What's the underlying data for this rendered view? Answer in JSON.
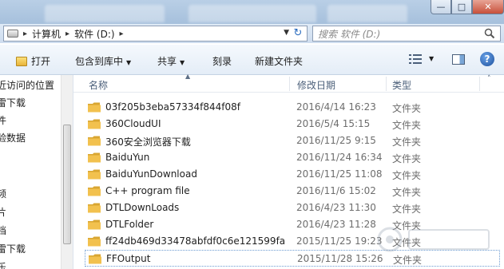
{
  "address": {
    "crumbs": [
      "计算机",
      "软件 (D:)"
    ],
    "search_placeholder": "搜索 软件 (D:)"
  },
  "toolbar": {
    "open_label": "打开",
    "include_label": "包含到库中",
    "share_label": "共享",
    "burn_label": "刻录",
    "new_folder_label": "新建文件夹"
  },
  "nav": {
    "items": [
      "近访问的位置",
      "雷下载",
      "件",
      "验数据",
      "频",
      "片",
      "档",
      "雷下载",
      "乐"
    ]
  },
  "columns": {
    "name": "名称",
    "modified": "修改日期",
    "type": "类型"
  },
  "files": [
    {
      "name": "03f205b3eba57334f844f08f",
      "modified": "2016/4/14 16:23",
      "type": "文件夹"
    },
    {
      "name": "360CloudUI",
      "modified": "2016/5/4 15:15",
      "type": "文件夹"
    },
    {
      "name": "360安全浏览器下载",
      "modified": "2016/11/25 9:15",
      "type": "文件夹"
    },
    {
      "name": "BaiduYun",
      "modified": "2016/11/24 16:34",
      "type": "文件夹"
    },
    {
      "name": "BaiduYunDownload",
      "modified": "2016/11/25 11:08",
      "type": "文件夹"
    },
    {
      "name": "C++ program file",
      "modified": "2016/11/6 15:02",
      "type": "文件夹"
    },
    {
      "name": "DTLDownLoads",
      "modified": "2016/4/23 11:30",
      "type": "文件夹"
    },
    {
      "name": "DTLFolder",
      "modified": "2016/4/23 11:28",
      "type": "文件夹"
    },
    {
      "name": "ff24db469d33478abfdf0c6e121599fa",
      "modified": "2015/11/25 19:23",
      "type": "文件夹"
    },
    {
      "name": "FFOutput",
      "modified": "2015/11/28 15:26",
      "type": "文件夹"
    }
  ],
  "colors": {
    "folder": "#f2c14e",
    "header_text": "#4c607a",
    "accent": "#1c4f9c"
  }
}
